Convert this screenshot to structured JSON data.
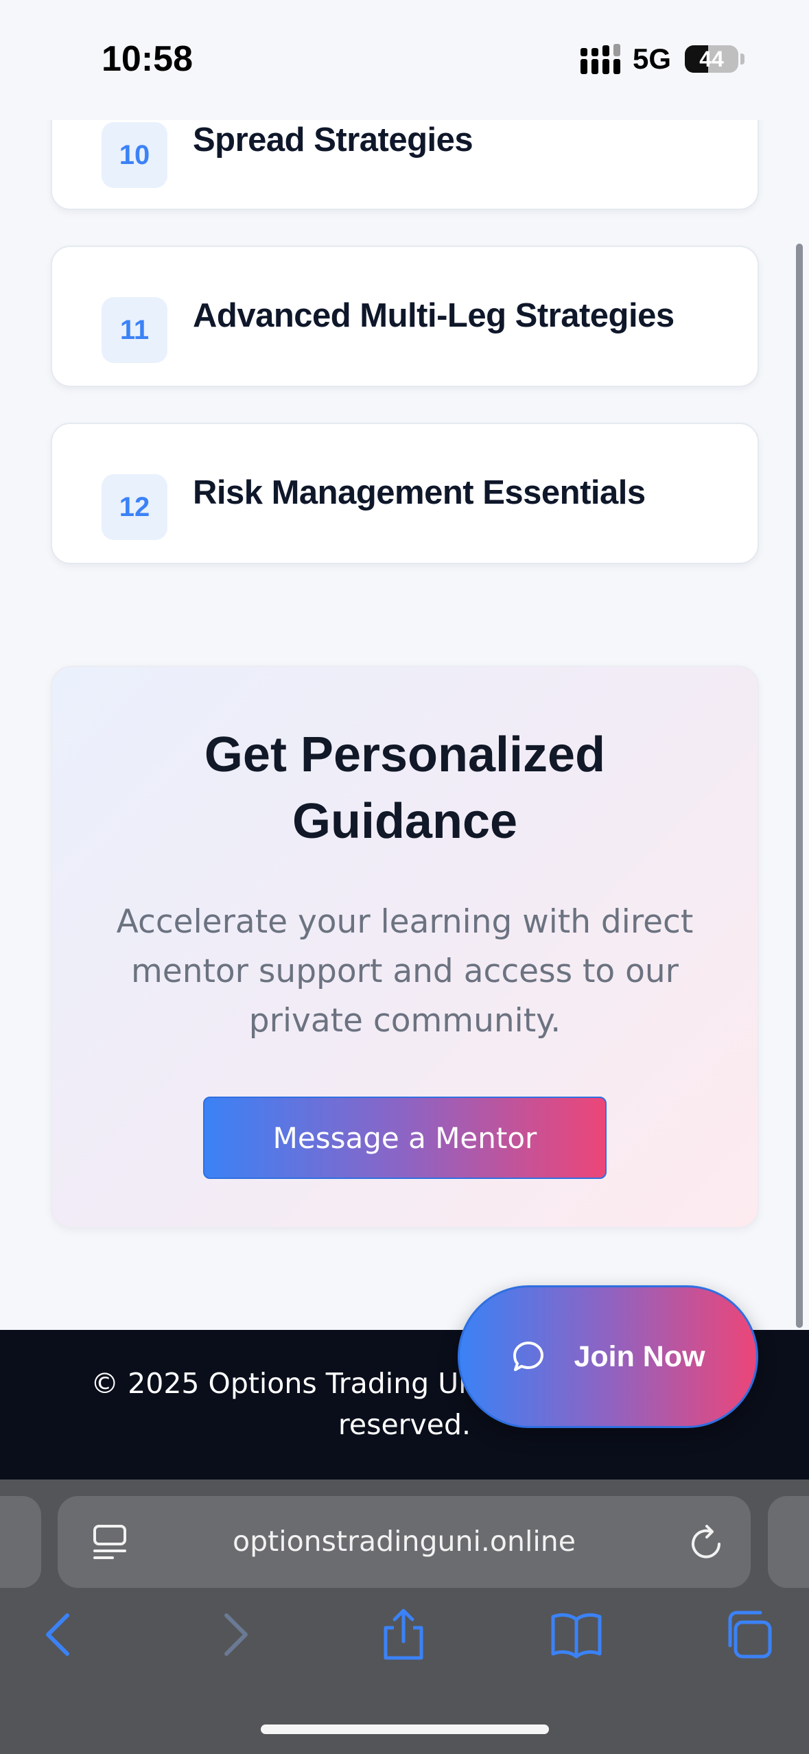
{
  "status_bar": {
    "time": "10:58",
    "network": "5G",
    "battery": "44",
    "battery_level": 0.44
  },
  "modules": [
    {
      "number": "10",
      "title": "Spread Strategies"
    },
    {
      "number": "11",
      "title": "Advanced Multi-Leg Strategies"
    },
    {
      "number": "12",
      "title": "Risk Management Essentials"
    }
  ],
  "guidance": {
    "title": "Get Personalized Guidance",
    "description": "Accelerate your learning with direct mentor support and access to our private community.",
    "button_label": "Message a Mentor"
  },
  "footer": {
    "copyright": "© 2025 Options Trading University. All rights reserved."
  },
  "floating_cta": {
    "label": "Join Now",
    "icon": "chat-bubble-icon"
  },
  "browser": {
    "url": "optionstradinguni.online",
    "toolbar_icons": [
      "back-icon",
      "forward-icon",
      "share-icon",
      "bookmarks-icon",
      "tabs-icon"
    ]
  },
  "colors": {
    "accent_blue": "#3b82f6",
    "accent_pink": "#ec4678",
    "footer_bg": "#0a0e1a",
    "browser_bar": "#545558",
    "toolbar_active": "#3b82f6",
    "toolbar_disabled": "#6b7a94"
  }
}
